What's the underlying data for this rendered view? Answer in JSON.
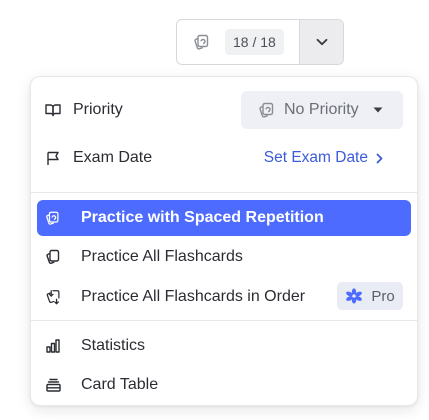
{
  "top_button": {
    "count": "18 / 18"
  },
  "menu": {
    "priority": {
      "label": "Priority",
      "value": "No Priority"
    },
    "exam_date": {
      "label": "Exam Date",
      "action": "Set Exam Date"
    },
    "practice_items": [
      {
        "label": "Practice with Spaced Repetition",
        "icon": "cards-cycle-icon",
        "active": true
      },
      {
        "label": "Practice All Flashcards",
        "icon": "cards-stack-icon",
        "active": false
      },
      {
        "label": "Practice All Flashcards in Order",
        "icon": "cards-order-icon",
        "active": false,
        "badge": "Pro"
      }
    ],
    "view_items": [
      {
        "label": "Statistics",
        "icon": "bar-chart-icon"
      },
      {
        "label": "Card Table",
        "icon": "table-icon"
      }
    ]
  },
  "colors": {
    "accent": "#4d6bfe",
    "link": "#3b5bdb",
    "pro_icon": "#4d6bfe"
  }
}
